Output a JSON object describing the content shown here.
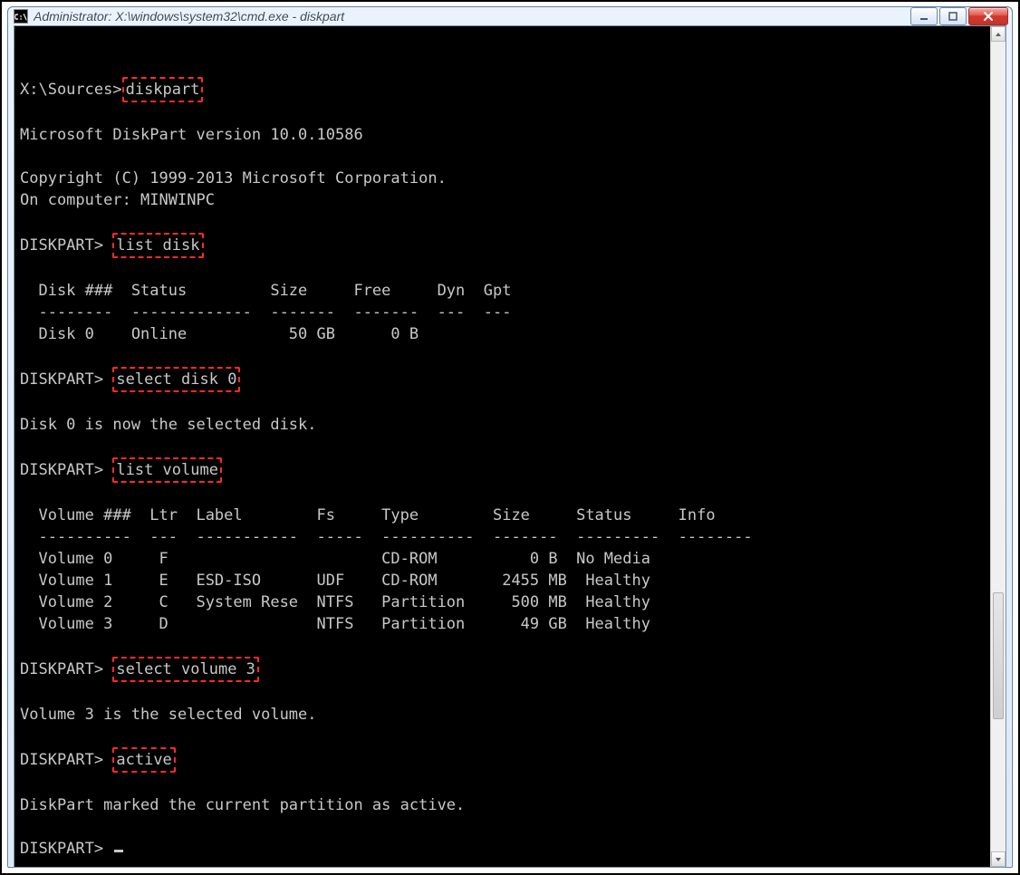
{
  "window": {
    "app_icon_label": "C:\\",
    "title": "Administrator: X:\\windows\\system32\\cmd.exe - diskpart"
  },
  "prompts": {
    "sources": "X:\\Sources>",
    "diskpart": "DISKPART>"
  },
  "commands": {
    "diskpart": "diskpart",
    "list_disk": "list disk",
    "select_disk_0": "select disk 0",
    "list_volume": "list volume",
    "select_volume_3": "select volume 3",
    "active": "active"
  },
  "output": {
    "blank": " ",
    "version_line": "Microsoft DiskPart version 10.0.10586",
    "copyright_line": "Copyright (C) 1999-2013 Microsoft Corporation.",
    "on_computer_line": "On computer: MINWINPC",
    "disk_header": "  Disk ###  Status         Size     Free     Dyn  Gpt",
    "disk_sep": "  --------  -------------  -------  -------  ---  ---",
    "disk_row_0": "  Disk 0    Online           50 GB      0 B           ",
    "selected_disk_msg": "Disk 0 is now the selected disk.",
    "vol_header": "  Volume ###  Ltr  Label        Fs     Type        Size     Status     Info",
    "vol_sep": "  ----------  ---  -----------  -----  ----------  -------  ---------  --------",
    "vol_row_0": "  Volume 0     F                       CD-ROM          0 B  No Media           ",
    "vol_row_1": "  Volume 1     E   ESD-ISO      UDF    CD-ROM       2455 MB  Healthy            ",
    "vol_row_2": "  Volume 2     C   System Rese  NTFS   Partition     500 MB  Healthy            ",
    "vol_row_3": "  Volume 3     D                NTFS   Partition      49 GB  Healthy            ",
    "selected_volume_msg": "Volume 3 is the selected volume.",
    "active_msg": "DiskPart marked the current partition as active."
  },
  "disk_table": {
    "headers": [
      "Disk ###",
      "Status",
      "Size",
      "Free",
      "Dyn",
      "Gpt"
    ],
    "rows": [
      {
        "disk": "Disk 0",
        "status": "Online",
        "size": "50 GB",
        "free": "0 B",
        "dyn": "",
        "gpt": ""
      }
    ]
  },
  "volume_table": {
    "headers": [
      "Volume ###",
      "Ltr",
      "Label",
      "Fs",
      "Type",
      "Size",
      "Status",
      "Info"
    ],
    "rows": [
      {
        "vol": "Volume 0",
        "ltr": "F",
        "label": "",
        "fs": "",
        "type": "CD-ROM",
        "size": "0 B",
        "status": "No Media",
        "info": ""
      },
      {
        "vol": "Volume 1",
        "ltr": "E",
        "label": "ESD-ISO",
        "fs": "UDF",
        "type": "CD-ROM",
        "size": "2455 MB",
        "status": "Healthy",
        "info": ""
      },
      {
        "vol": "Volume 2",
        "ltr": "C",
        "label": "System Rese",
        "fs": "NTFS",
        "type": "Partition",
        "size": "500 MB",
        "status": "Healthy",
        "info": ""
      },
      {
        "vol": "Volume 3",
        "ltr": "D",
        "label": "",
        "fs": "NTFS",
        "type": "Partition",
        "size": "49 GB",
        "status": "Healthy",
        "info": ""
      }
    ]
  }
}
